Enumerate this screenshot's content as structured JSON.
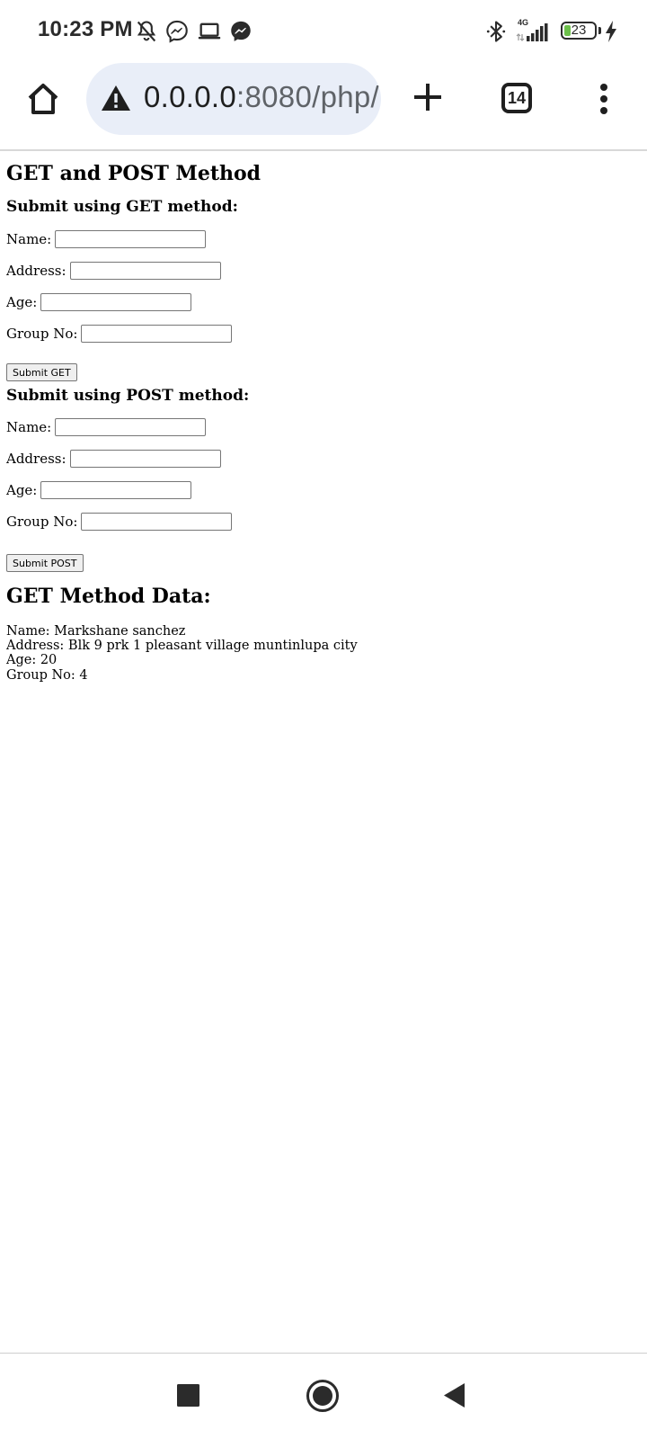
{
  "status_bar": {
    "time": "10:23 PM",
    "network_label": "4G",
    "battery_level": "23",
    "battery_fraction": 0.23,
    "icons": [
      "bell-off-icon",
      "messenger-icon",
      "laptop-icon",
      "messenger-icon",
      "bluetooth-icon",
      "signal-icon",
      "battery-icon",
      "charging-bolt-icon"
    ]
  },
  "browser": {
    "url_host": "0.0.0.0",
    "url_rest": ":8080/php/",
    "tab_count": "14",
    "icons": [
      "home-icon",
      "warning-icon",
      "new-tab-plus-icon",
      "tabs-icon",
      "more-menu-icon"
    ]
  },
  "page": {
    "title": "GET and POST Method",
    "get_form": {
      "heading": "Submit using GET method:",
      "name_label": "Name:",
      "address_label": "Address:",
      "age_label": "Age:",
      "group_label": "Group No:",
      "submit_label": "Submit GET"
    },
    "post_form": {
      "heading": "Submit using POST method:",
      "name_label": "Name:",
      "address_label": "Address:",
      "age_label": "Age:",
      "group_label": "Group No:",
      "submit_label": "Submit POST"
    },
    "get_data": {
      "heading": "GET Method Data:",
      "name_line": "Name: Markshane sanchez",
      "address_line": "Address: Blk 9 prk 1 pleasant village muntinlupa city",
      "age_line": "Age: 20",
      "group_line": "Group No: 4"
    }
  },
  "nav_bar": {
    "icons": [
      "recents-square-icon",
      "home-circle-icon",
      "back-triangle-icon"
    ]
  },
  "colors": {
    "url_pill_bg": "#e9eef8",
    "battery_fill": "#6cc04a",
    "text_dark": "#1f1f1f"
  }
}
